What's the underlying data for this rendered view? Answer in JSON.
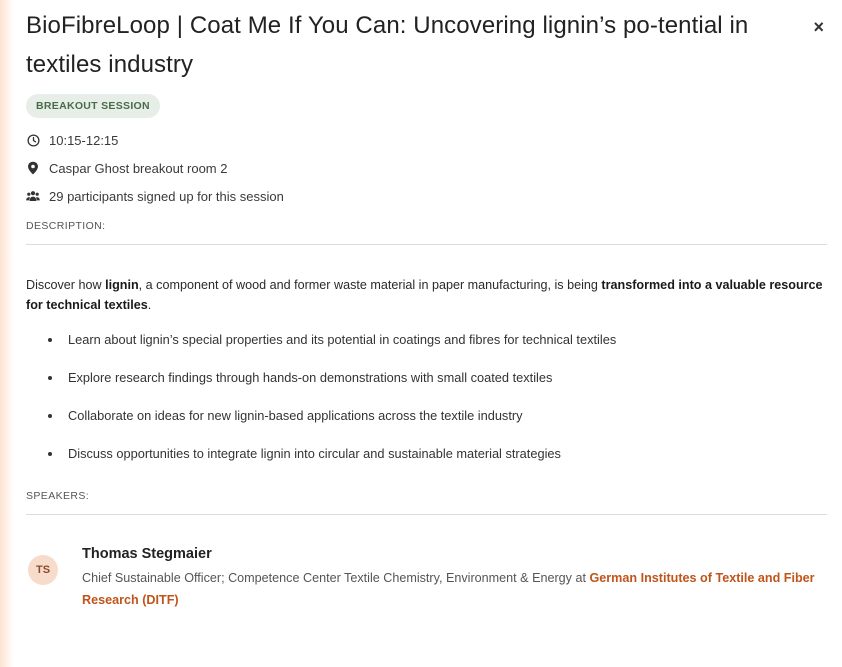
{
  "session": {
    "title": "BioFibreLoop | Coat Me If You Can: Uncovering lignin’s po-tential in textiles industry",
    "badge": "BREAKOUT SESSION",
    "time": "10:15-12:15",
    "location": "Caspar Ghost breakout room 2",
    "participants": "29 participants signed up for this session",
    "close_label": "×"
  },
  "description": {
    "label": "DESCRIPTION:",
    "intro_1": "Discover how ",
    "intro_bold_1": "lignin",
    "intro_2": ", a component of wood and former waste material in paper manufacturing, is being ",
    "intro_bold_2": "transformed into a valuable resource for technical textiles",
    "intro_3": ".",
    "bullets": [
      "Learn about lignin’s special properties and its potential in coatings and fibres for technical textiles",
      "Explore research findings through hands-on demonstrations with small coated textiles",
      "Collaborate on ideas for new lignin-based applications across the textile industry",
      "Discuss opportunities to integrate lignin into circular and sustainable material strategies"
    ]
  },
  "speakers": {
    "label": "SPEAKERS:",
    "items": [
      {
        "initials": "TS",
        "name": "Thomas Stegmaier",
        "role": "Chief Sustainable Officer; Competence Center Textile Chemistry, Environment & Energy at ",
        "org": "German Institutes of Textile and Fiber Research (DITF)"
      }
    ]
  },
  "icons": {
    "time": "clock-icon",
    "location": "map-pin-icon",
    "participants": "people-icon",
    "close": "close-icon"
  },
  "colors": {
    "accent": "#c0541a",
    "badge_bg": "#e7eee7",
    "badge_text": "#4a6b4a",
    "avatar_bg": "#f8dccb"
  }
}
